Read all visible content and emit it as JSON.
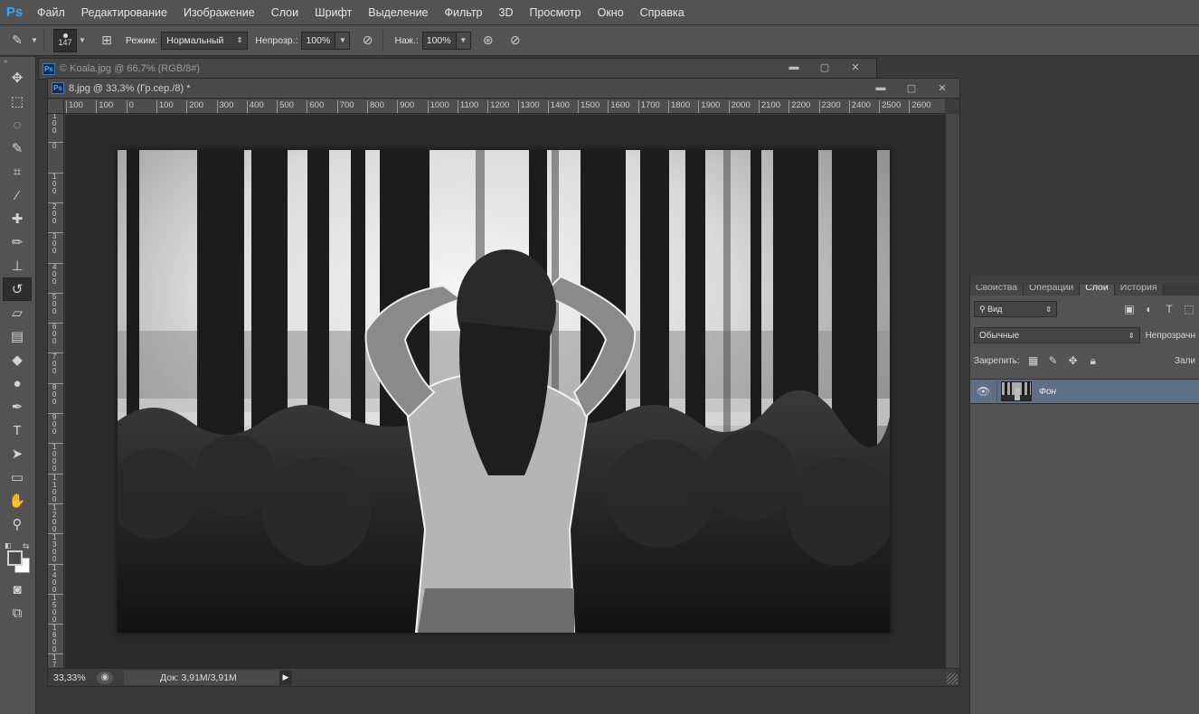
{
  "app": {
    "logo": "Ps"
  },
  "menu": [
    "Файл",
    "Редактирование",
    "Изображение",
    "Слои",
    "Шрифт",
    "Выделение",
    "Фильтр",
    "3D",
    "Просмотр",
    "Окно",
    "Справка"
  ],
  "options": {
    "brush_size": "147",
    "mode_label": "Режим:",
    "mode_value": "Нормальный",
    "opacity_label": "Непрозр.:",
    "opacity_value": "100%",
    "flow_label": "Наж.:",
    "flow_value": "100%"
  },
  "tools": [
    {
      "name": "move-tool",
      "glyph": "✥"
    },
    {
      "name": "marquee-tool",
      "glyph": "⬚"
    },
    {
      "name": "lasso-tool",
      "glyph": "◌"
    },
    {
      "name": "quick-selection-tool",
      "glyph": "✎"
    },
    {
      "name": "crop-tool",
      "glyph": "⌗"
    },
    {
      "name": "eyedropper-tool",
      "glyph": "⁄"
    },
    {
      "name": "healing-brush-tool",
      "glyph": "✚"
    },
    {
      "name": "brush-tool",
      "glyph": "✏"
    },
    {
      "name": "clone-stamp-tool",
      "glyph": "⊥"
    },
    {
      "name": "history-brush-tool",
      "glyph": "↺"
    },
    {
      "name": "eraser-tool",
      "glyph": "▱"
    },
    {
      "name": "gradient-tool",
      "glyph": "▤"
    },
    {
      "name": "blur-tool",
      "glyph": "◆"
    },
    {
      "name": "dodge-tool",
      "glyph": "●"
    },
    {
      "name": "pen-tool",
      "glyph": "✒"
    },
    {
      "name": "type-tool",
      "glyph": "T"
    },
    {
      "name": "path-selection-tool",
      "glyph": "➤"
    },
    {
      "name": "shape-tool",
      "glyph": "▭"
    },
    {
      "name": "hand-tool",
      "glyph": "✋"
    },
    {
      "name": "zoom-tool",
      "glyph": "⚲"
    }
  ],
  "active_tool": "history-brush-tool",
  "documents": {
    "background_title": "Koala.jpg @ 66,7% (RGB/8#)",
    "active_title": "8.jpg @ 33,3% (Гр.сер./8) *",
    "window_buttons": [
      "▬",
      "▢",
      "✕"
    ]
  },
  "ruler": {
    "top_labels": [
      "100",
      "100",
      "0",
      "100",
      "200",
      "300",
      "400",
      "500",
      "600",
      "700",
      "800",
      "900",
      "1000",
      "1100",
      "1200",
      "1300",
      "1400",
      "1500",
      "1600",
      "1700",
      "1800",
      "1900",
      "2000",
      "2100",
      "2200",
      "2300",
      "2400",
      "2500",
      "2600"
    ],
    "left_labels": [
      "1 0 0",
      "0",
      "1 0 0",
      "2 0 0",
      "3 0 0",
      "4 0 0",
      "5 0 0",
      "6 0 0",
      "7 0 0",
      "8 0 0",
      "9 0 0",
      "1 0 0 0",
      "1 1 0 0",
      "1 2 0 0",
      "1 3 0 0",
      "1 4 0 0",
      "1 5 0 0",
      "1 6 0 0",
      "1 7 0 0"
    ]
  },
  "status": {
    "zoom": "33,33%",
    "doc_info": "Док: 3,91M/3,91M"
  },
  "panel": {
    "tabs": [
      "Свойства",
      "Операции",
      "Слои",
      "История"
    ],
    "active_tab": "Слои",
    "filter_label": "Вид",
    "blend_mode": "Обычные",
    "opacity_label": "Непрозрачн",
    "lock_label": "Закрепить:",
    "fill_label": "Зали",
    "layers": [
      {
        "name": "Фон",
        "visible": true
      }
    ]
  }
}
